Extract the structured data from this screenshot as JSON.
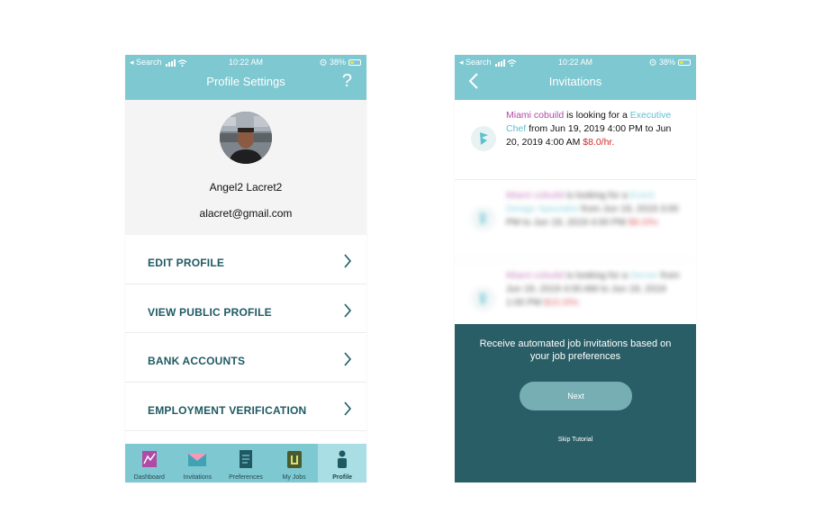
{
  "colors": {
    "header": "#7ec8d1",
    "accent_teal": "#1f5a63",
    "tutorial_bg": "#2a5e67",
    "company": "#b04aa6",
    "role": "#5ec0d0",
    "rate": "#cc2a2a"
  },
  "status_bar": {
    "carrier": "◂ Search",
    "time": "10:22 AM",
    "battery": "38%"
  },
  "profile_screen": {
    "title": "Profile Settings",
    "help": "?",
    "name": "Angel2 Lacret2",
    "email": "alacret@gmail.com",
    "menu": [
      {
        "label": "EDIT PROFILE"
      },
      {
        "label": "VIEW PUBLIC PROFILE"
      },
      {
        "label": "BANK ACCOUNTS"
      },
      {
        "label": "EMPLOYMENT VERIFICATION"
      }
    ],
    "tabs": [
      {
        "label": "Dashboard",
        "icon": "dashboard-icon"
      },
      {
        "label": "Invitations",
        "icon": "envelope-icon"
      },
      {
        "label": "Preferences",
        "icon": "document-icon"
      },
      {
        "label": "My Jobs",
        "icon": "briefcase-icon"
      },
      {
        "label": "Profile",
        "icon": "person-icon",
        "active": true
      }
    ]
  },
  "invitations_screen": {
    "title": "Invitations",
    "items": [
      {
        "company": "Miami cobuild",
        "mid": " is looking for a ",
        "role": "Executive Chef",
        "schedule": " from Jun 19, 2019 4:00 PM to Jun 20, 2019 4:00 AM ",
        "rate": "$8.0/hr."
      },
      {
        "company": "Miami cobuild",
        "mid": " is looking for a ",
        "role": "Event Design Specialist",
        "schedule": " from Jun 19, 2019 3:00 PM to Jun 19, 2019 4:00 PM ",
        "rate": "$8.0/hr."
      },
      {
        "company": "Miami cobuild",
        "mid": " is looking for a ",
        "role": "Server",
        "schedule": " from Jun 19, 2019 4:00 AM to Jun 19, 2019 1:00 PM ",
        "rate": "$15.0/hr."
      }
    ],
    "tutorial_text": "Receive automated job invitations based on your job preferences",
    "next_label": "Next",
    "skip_label": "Skip Tutorial"
  }
}
